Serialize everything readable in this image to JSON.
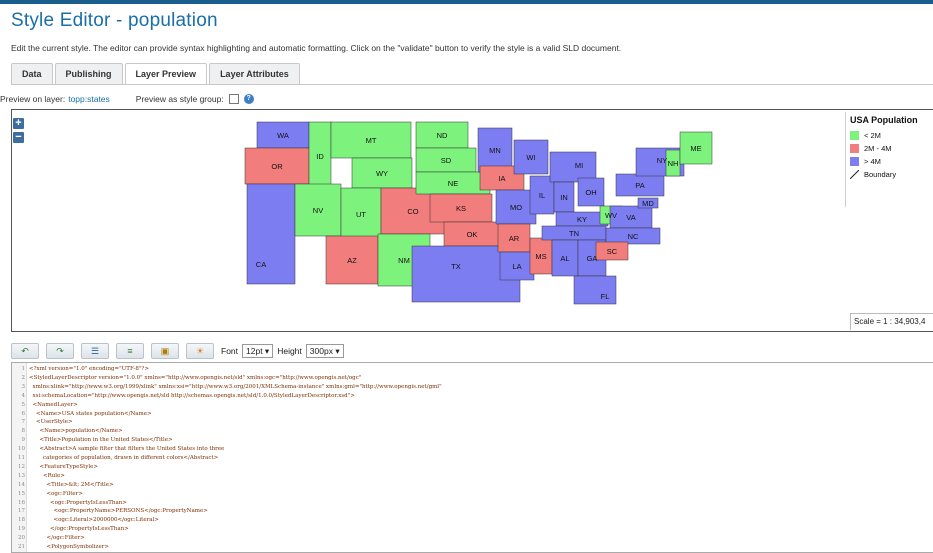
{
  "header": {
    "title": "Style Editor - population",
    "description": "Edit the current style. The editor can provide syntax highlighting and automatic formatting. Click on the \"validate\" button to verify the style is a valid SLD document."
  },
  "tabs": [
    {
      "label": "Data"
    },
    {
      "label": "Publishing"
    },
    {
      "label": "Layer Preview",
      "active": true
    },
    {
      "label": "Layer Attributes"
    }
  ],
  "preview": {
    "layer_label": "Preview on layer:",
    "layer_value": "topp:states",
    "group_label": "Preview as style group:"
  },
  "map": {
    "zoom_in": "+",
    "zoom_out": "−",
    "legend": {
      "title": "USA Population",
      "items": [
        {
          "label": "< 2M",
          "color": "#7df27d"
        },
        {
          "label": "2M - 4M",
          "color": "#f27d7d"
        },
        {
          "label": "> 4M",
          "color": "#7d7df2"
        },
        {
          "label": "Boundary",
          "color": "#000000"
        }
      ]
    },
    "scale": "Scale = 1 : 34,903,4",
    "states": [
      {
        "abbr": "WA",
        "c": "b"
      },
      {
        "abbr": "OR",
        "c": "r"
      },
      {
        "abbr": "CA",
        "c": "b"
      },
      {
        "abbr": "ID",
        "c": "g"
      },
      {
        "abbr": "NV",
        "c": "g"
      },
      {
        "abbr": "MT",
        "c": "g"
      },
      {
        "abbr": "WY",
        "c": "g"
      },
      {
        "abbr": "UT",
        "c": "g"
      },
      {
        "abbr": "AZ",
        "c": "r"
      },
      {
        "abbr": "CO",
        "c": "r"
      },
      {
        "abbr": "NM",
        "c": "g"
      },
      {
        "abbr": "ND",
        "c": "g"
      },
      {
        "abbr": "SD",
        "c": "g"
      },
      {
        "abbr": "NE",
        "c": "g"
      },
      {
        "abbr": "KS",
        "c": "r"
      },
      {
        "abbr": "OK",
        "c": "r"
      },
      {
        "abbr": "TX",
        "c": "b"
      },
      {
        "abbr": "MN",
        "c": "b"
      },
      {
        "abbr": "IA",
        "c": "r"
      },
      {
        "abbr": "MO",
        "c": "b"
      },
      {
        "abbr": "AR",
        "c": "r"
      },
      {
        "abbr": "LA",
        "c": "b"
      },
      {
        "abbr": "WI",
        "c": "b"
      },
      {
        "abbr": "IL",
        "c": "b"
      },
      {
        "abbr": "MS",
        "c": "r"
      },
      {
        "abbr": "MI",
        "c": "b"
      },
      {
        "abbr": "IN",
        "c": "b"
      },
      {
        "abbr": "KY",
        "c": "b"
      },
      {
        "abbr": "TN",
        "c": "b"
      },
      {
        "abbr": "AL",
        "c": "b"
      },
      {
        "abbr": "GA",
        "c": "b"
      },
      {
        "abbr": "FL",
        "c": "b"
      },
      {
        "abbr": "OH",
        "c": "b"
      },
      {
        "abbr": "WV",
        "c": "g"
      },
      {
        "abbr": "VA",
        "c": "b"
      },
      {
        "abbr": "NC",
        "c": "b"
      },
      {
        "abbr": "SC",
        "c": "r"
      },
      {
        "abbr": "PA",
        "c": "b"
      },
      {
        "abbr": "NY",
        "c": "b"
      },
      {
        "abbr": "MD",
        "c": "b"
      },
      {
        "abbr": "NH",
        "c": "g"
      },
      {
        "abbr": "ME",
        "c": "g"
      }
    ]
  },
  "toolbar": {
    "font_label": "Font",
    "font_value": "12pt",
    "height_label": "Height",
    "height_value": "300px"
  },
  "editor": {
    "lines": [
      "<?xml version=\"1.0\" encoding=\"UTF-8\"?>",
      "<StyledLayerDescriptor version=\"1.0.0\" xmlns=\"http://www.opengis.net/sld\" xmlns:ogc=\"http://www.opengis.net/ogc\"",
      "  xmlns:xlink=\"http://www.w3.org/1999/xlink\" xmlns:xsi=\"http://www.w3.org/2001/XMLSchema-instance\" xmlns:gml=\"http://www.opengis.net/gml\"",
      "  xsi:schemaLocation=\"http://www.opengis.net/sld http://schemas.opengis.net/sld/1.0.0/StyledLayerDescriptor.xsd\">",
      "  <NamedLayer>",
      "    <Name>USA states population</Name>",
      "    <UserStyle>",
      "      <Name>population</Name>",
      "      <Title>Population in the United States</Title>",
      "      <Abstract>A sample filter that filters the United States into three",
      "        categories of population, drawn in different colors</Abstract>",
      "      <FeatureTypeStyle>",
      "        <Rule>",
      "          <Title>&lt; 2M</Title>",
      "          <ogc:Filter>",
      "            <ogc:PropertyIsLessThan>",
      "              <ogc:PropertyName>PERSONS</ogc:PropertyName>",
      "              <ogc:Literal>2000000</ogc:Literal>",
      "            </ogc:PropertyIsLessThan>",
      "          </ogc:Filter>",
      "          <PolygonSymbolizer>"
    ]
  }
}
